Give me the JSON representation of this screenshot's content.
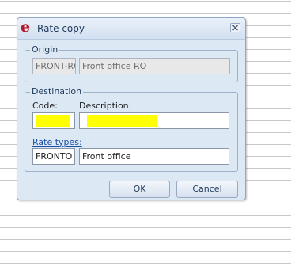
{
  "dialog": {
    "title": "Rate copy",
    "logo_letter": "e",
    "close_icon": "close-x"
  },
  "origin": {
    "legend": "Origin",
    "code": "FRONT-RO",
    "description": "Front office RO"
  },
  "destination": {
    "legend": "Destination",
    "code_label": "Code:",
    "description_label": "Description:",
    "code_value": "",
    "description_value": ""
  },
  "rate_types": {
    "label": "Rate types:",
    "code": "FRONTO",
    "description": "Front office"
  },
  "buttons": {
    "ok": "OK",
    "cancel": "Cancel"
  },
  "colors": {
    "logo": "#b3192a",
    "highlight": "#ffff00",
    "dialog_bg": "#dde8f5"
  }
}
